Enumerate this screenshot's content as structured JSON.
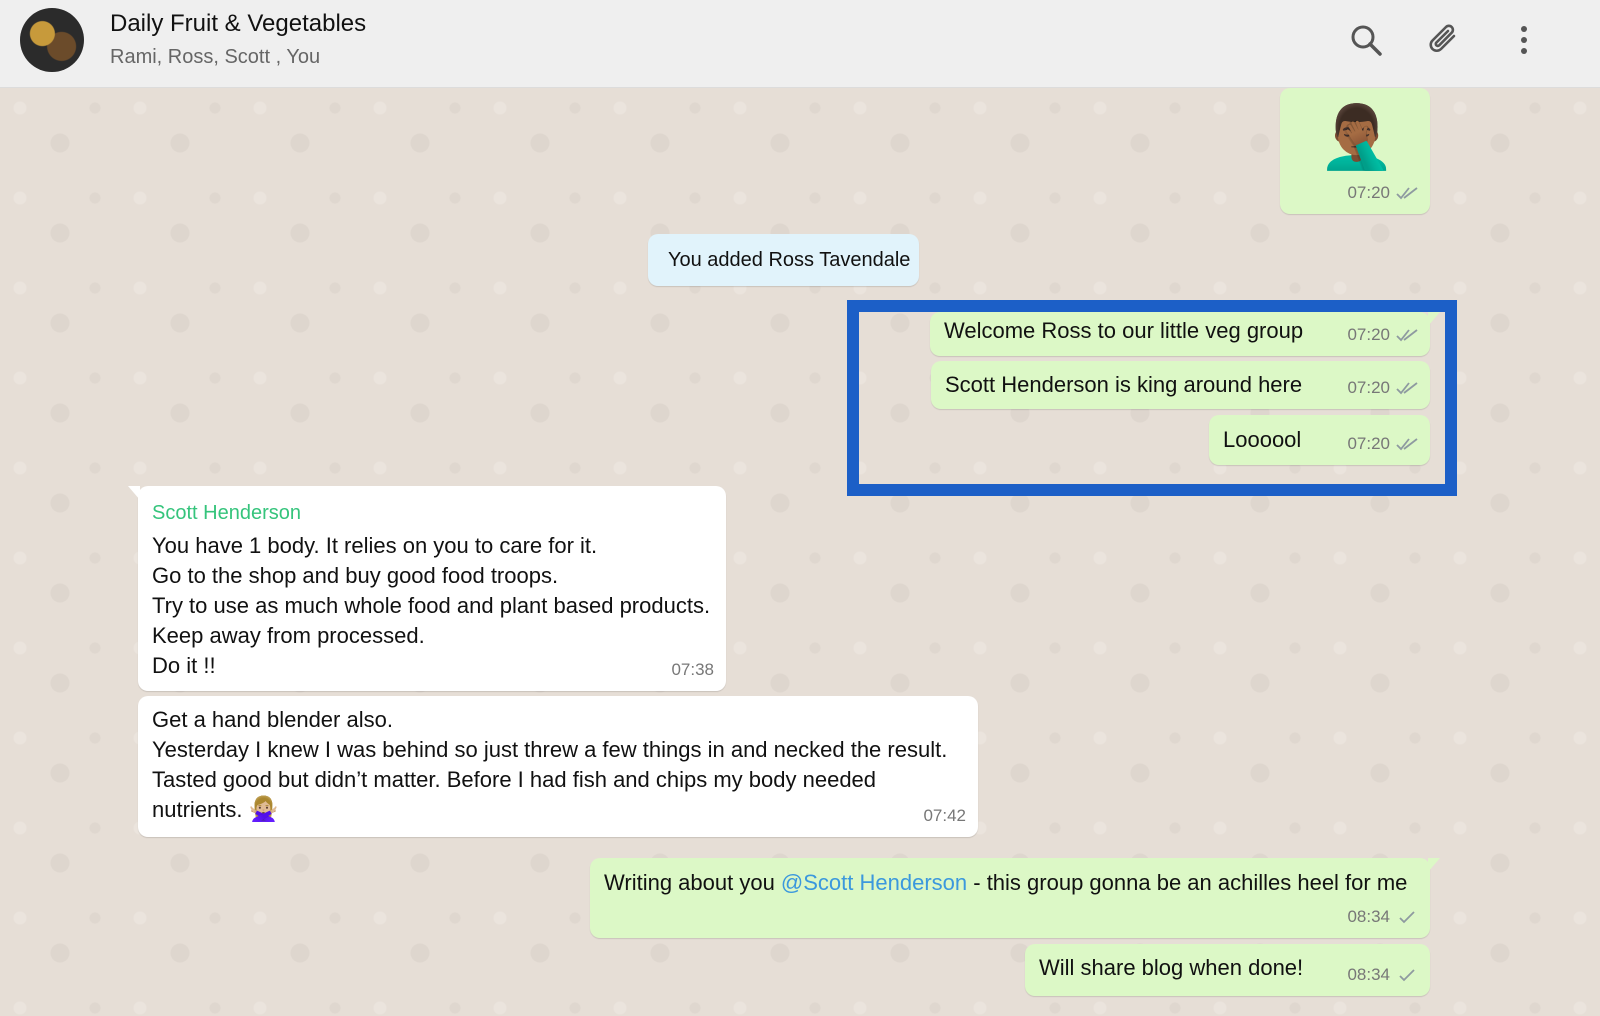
{
  "header": {
    "title": "Daily Fruit & Vegetables",
    "members": "Rami, Ross, Scott , You",
    "icons": [
      "search-icon",
      "attach-icon",
      "menu-icon"
    ]
  },
  "messages": [
    {
      "type": "out",
      "emoji": "🤦🏾‍♂️",
      "time": "07:20",
      "status": "read"
    },
    {
      "type": "system",
      "text": "You added Ross Tavendale"
    },
    {
      "type": "out",
      "text": "Welcome Ross to our little veg group",
      "time": "07:20",
      "status": "read"
    },
    {
      "type": "out",
      "text": "Scott Henderson is king around here",
      "time": "07:20",
      "status": "read"
    },
    {
      "type": "out",
      "text": "Loooool",
      "time": "07:20",
      "status": "read"
    },
    {
      "type": "in",
      "sender": "Scott Henderson",
      "lines": [
        "You have 1 body. It relies on you to care for it.",
        "Go to the shop and buy good food troops.",
        "Try to use as much whole food and plant based products.",
        "Keep away from processed.",
        "Do it !!"
      ],
      "time": "07:38"
    },
    {
      "type": "in",
      "lines": [
        "Get a hand blender also.",
        "Yesterday I knew I was behind so just threw a few things in and necked the result.",
        "Tasted good but didn’t matter. Before I had fish and chips my body needed",
        "nutrients."
      ],
      "emoji": "🙅🏼‍♀️",
      "time": "07:42"
    },
    {
      "type": "out",
      "text_before": "Writing about you ",
      "mention": "@Scott Henderson",
      "text_after": " - this group gonna be an achilles heel for me",
      "time": "08:34",
      "status": "sent"
    },
    {
      "type": "out",
      "text": "Will share blog when done!",
      "time": "08:34",
      "status": "sent"
    }
  ],
  "colors": {
    "outgoing": "#dcf8c6",
    "incoming": "#ffffff",
    "system": "#e1f3fb",
    "sender_name": "#35c47c",
    "mention": "#3b98dd",
    "highlight": "#1c5fc7"
  }
}
